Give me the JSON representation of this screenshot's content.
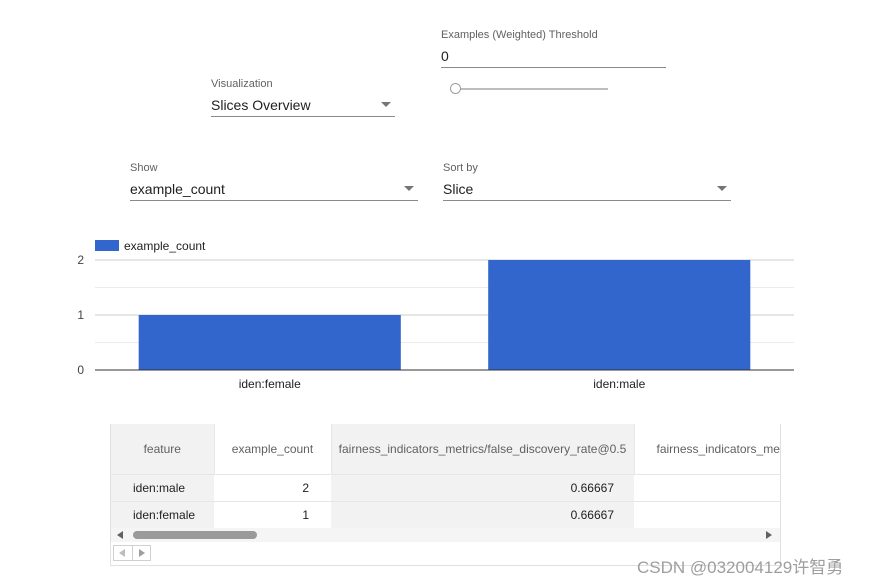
{
  "threshold": {
    "label": "Examples (Weighted) Threshold",
    "value": "0",
    "slider_fraction": 0
  },
  "visualization": {
    "label": "Visualization",
    "value": "Slices Overview"
  },
  "show": {
    "label": "Show",
    "value": "example_count"
  },
  "sort_by": {
    "label": "Sort by",
    "value": "Slice"
  },
  "chart_data": {
    "type": "bar",
    "categories": [
      "iden:female",
      "iden:male"
    ],
    "series": [
      {
        "name": "example_count",
        "values": [
          1,
          2
        ],
        "color": "#3366cc"
      }
    ],
    "y_ticks": [
      "0",
      "1",
      "2"
    ],
    "ylim": [
      0,
      2
    ],
    "grid": true,
    "legend_position": "top-left"
  },
  "table": {
    "headers": [
      "feature",
      "example_count",
      "fairness_indicators_metrics/false_discovery_rate@0.5",
      "fairness_indicators_metrics/"
    ],
    "rows": [
      [
        "iden:male",
        "2",
        "0.66667",
        ""
      ],
      [
        "iden:female",
        "1",
        "0.66667",
        ""
      ]
    ]
  },
  "watermark": "CSDN @032004129许智勇"
}
